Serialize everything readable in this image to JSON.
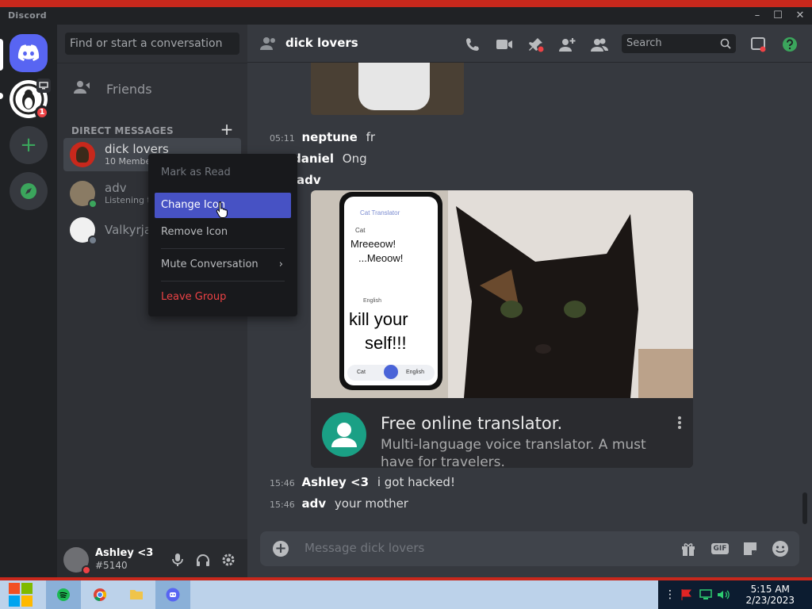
{
  "app": {
    "name": "Discord"
  },
  "window": {
    "minimize": "–",
    "maximize": "☐",
    "close": "✕"
  },
  "guilds": {
    "badge": "1",
    "add": "+"
  },
  "sidebar": {
    "search_placeholder": "Find or start a conversation",
    "friends_label": "Friends",
    "dm_header": "DIRECT MESSAGES",
    "dm_add": "+",
    "dms": [
      {
        "name": "dick lovers",
        "sub": "10 Members"
      },
      {
        "name": "adv",
        "sub": "Listening to"
      },
      {
        "name": "Valkyrja",
        "sub": ""
      }
    ]
  },
  "user": {
    "name": "Ashley <3",
    "tag": "#5140"
  },
  "channel": {
    "title": "dick lovers",
    "search_placeholder": "Search"
  },
  "messages": [
    {
      "time": "05:11",
      "author": "neptune",
      "text": "fr"
    },
    {
      "time": "",
      "author": "daniel",
      "text": "Ong"
    },
    {
      "time": "",
      "author": "adv",
      "text": ""
    },
    {
      "time": "15:46",
      "author": "Ashley <3",
      "text": "i got hacked!"
    },
    {
      "time": "15:46",
      "author": "adv",
      "text": "your mother"
    }
  ],
  "embed": {
    "phone_app": "Cat Translator",
    "phone_cat_label": "Cat",
    "phone_line1": "Mreeeow!",
    "phone_line2": "...Meoow!",
    "phone_lang": "English",
    "phone_big1": "kill your",
    "phone_big2": "self!!!",
    "phone_btn_left": "Cat",
    "phone_btn_right": "English",
    "title": "Free online translator.",
    "description": "Multi-language voice translator. A must have for travelers."
  },
  "composer": {
    "placeholder": "Message dick lovers",
    "gif": "GIF"
  },
  "context_menu": {
    "mark_read": "Mark as Read",
    "change_icon": "Change Icon",
    "remove_icon": "Remove Icon",
    "mute": "Mute Conversation",
    "leave": "Leave Group"
  },
  "taskbar": {
    "time": "5:15 AM",
    "date": "2/23/2023"
  },
  "colors": {
    "blurple": "#5865f2",
    "green": "#3ba55c",
    "red": "#ed4245",
    "highlight": "#4752c4"
  }
}
